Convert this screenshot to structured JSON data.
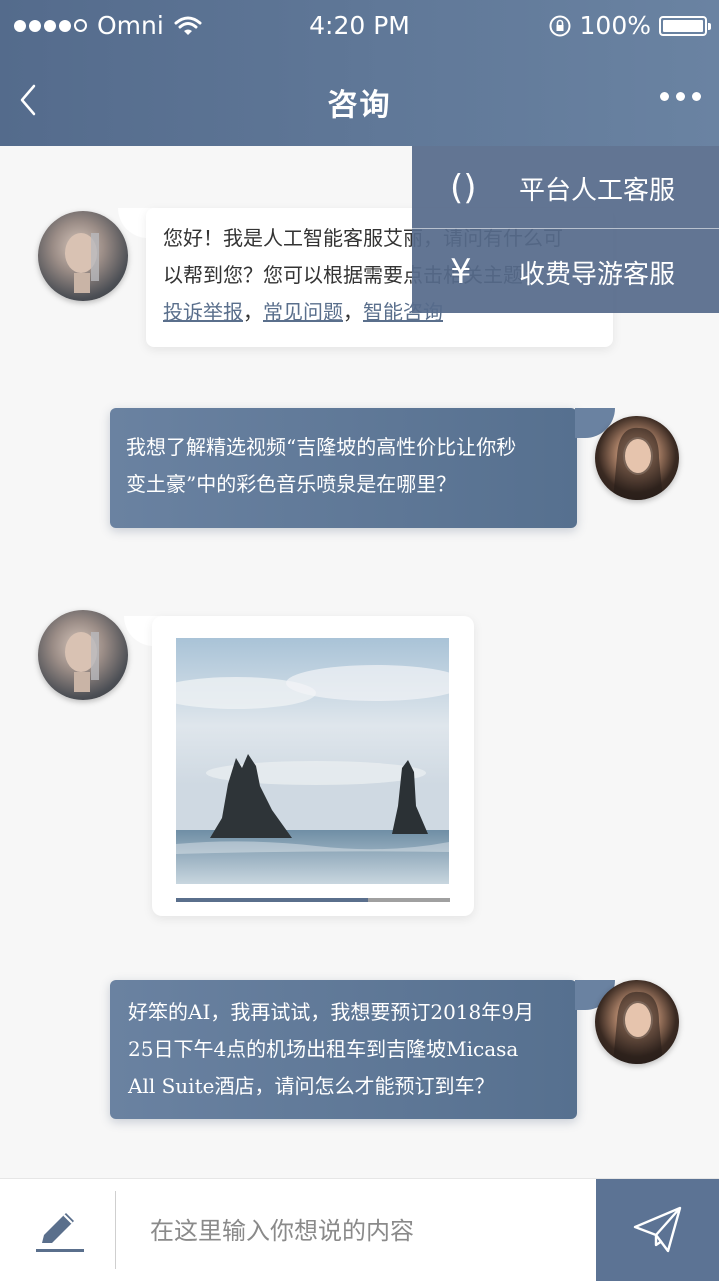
{
  "status_bar": {
    "carrier": "Omni",
    "time": "4:20 PM",
    "battery": "100%"
  },
  "nav": {
    "title": "咨询"
  },
  "dropdown": {
    "items": [
      {
        "icon_char": "()",
        "label": "平台人工客服"
      },
      {
        "icon_char": "¥",
        "label": "收费导游客服"
      }
    ]
  },
  "messages": [
    {
      "sender": "ai",
      "line1": "您好！我是人工智能客服艾丽，请问有什么可",
      "line2": "以帮到您？您可以根据需要点击相关主题：",
      "links": [
        "投诉举报",
        "常见问题",
        "智能咨询"
      ],
      "separator": "，"
    },
    {
      "sender": "user",
      "line1": "我想了解精选视频“吉隆坡的高性价比让你秒",
      "line2": "变土豪”中的彩色音乐喷泉是在哪里？"
    },
    {
      "sender": "ai",
      "type": "video",
      "progress": 0.7
    },
    {
      "sender": "user",
      "line1": "好笨的AI，我再试试，我想要预订2018年9月",
      "line2": "25日下午4点的机场出租车到吉隆坡Micasa",
      "line3": "All Suite酒店，请问怎么才能预订到车？"
    }
  ],
  "composer": {
    "placeholder": "在这里输入你想说的内容"
  },
  "icons": {
    "back": "chevron-left-icon",
    "more": "more-horizontal-icon",
    "edit": "pencil-icon",
    "send": "paper-plane-icon"
  },
  "colors": {
    "header": "#5f7797",
    "user_bubble": "#5f7797",
    "link": "#5a6f8c"
  }
}
